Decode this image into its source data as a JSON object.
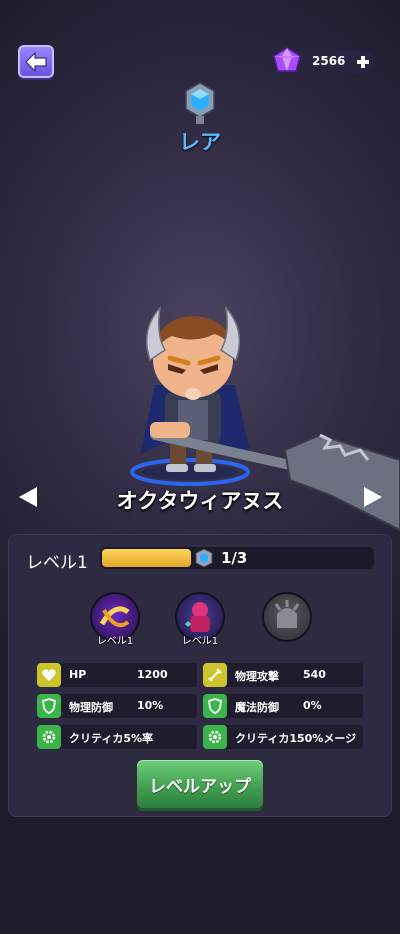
{
  "header": {
    "currency_amount": "2566",
    "currency_icon": "purple-gem-icon",
    "add_icon": "plus-icon",
    "back_icon": "arrow-left-icon"
  },
  "hero": {
    "rarity": "レア",
    "rarity_icon": "blue-crystal-icon",
    "name": "オクタウィアヌス"
  },
  "level": {
    "label": "レベル1",
    "progress_text": "1/3",
    "progress_fraction": 0.33
  },
  "skills": [
    {
      "level": "レベル1",
      "locked": false,
      "icon": "spinning-blade-skill-icon"
    },
    {
      "level": "レベル1",
      "locked": false,
      "icon": "pink-warrior-skill-icon"
    },
    {
      "level": "",
      "locked": true,
      "icon": "locked-skill-icon"
    }
  ],
  "stats": {
    "hp": {
      "name": "HP",
      "value": "1200",
      "icon": "heart-icon"
    },
    "phys_attack": {
      "name": "物理攻撃",
      "value": "540",
      "icon": "sword-icon"
    },
    "phys_defense": {
      "name": "物理防御",
      "value": "10%",
      "icon": "shield-icon"
    },
    "magic_defense": {
      "name": "魔法防御",
      "value": "0%",
      "icon": "shield-icon"
    },
    "crit_rate": {
      "name": "クリティカ5%率",
      "value": "",
      "icon": "gear-icon"
    },
    "crit_damage": {
      "name": "クリティカ150%メージ",
      "value": "",
      "icon": "gear-icon"
    }
  },
  "buttons": {
    "level_up": "レベルアップ"
  },
  "colors": {
    "accent_blue": "#58b8ff",
    "xp_gold": "#f0b83a",
    "button_green": "#3f9c4e",
    "panel_bg": "#2d2a41"
  }
}
